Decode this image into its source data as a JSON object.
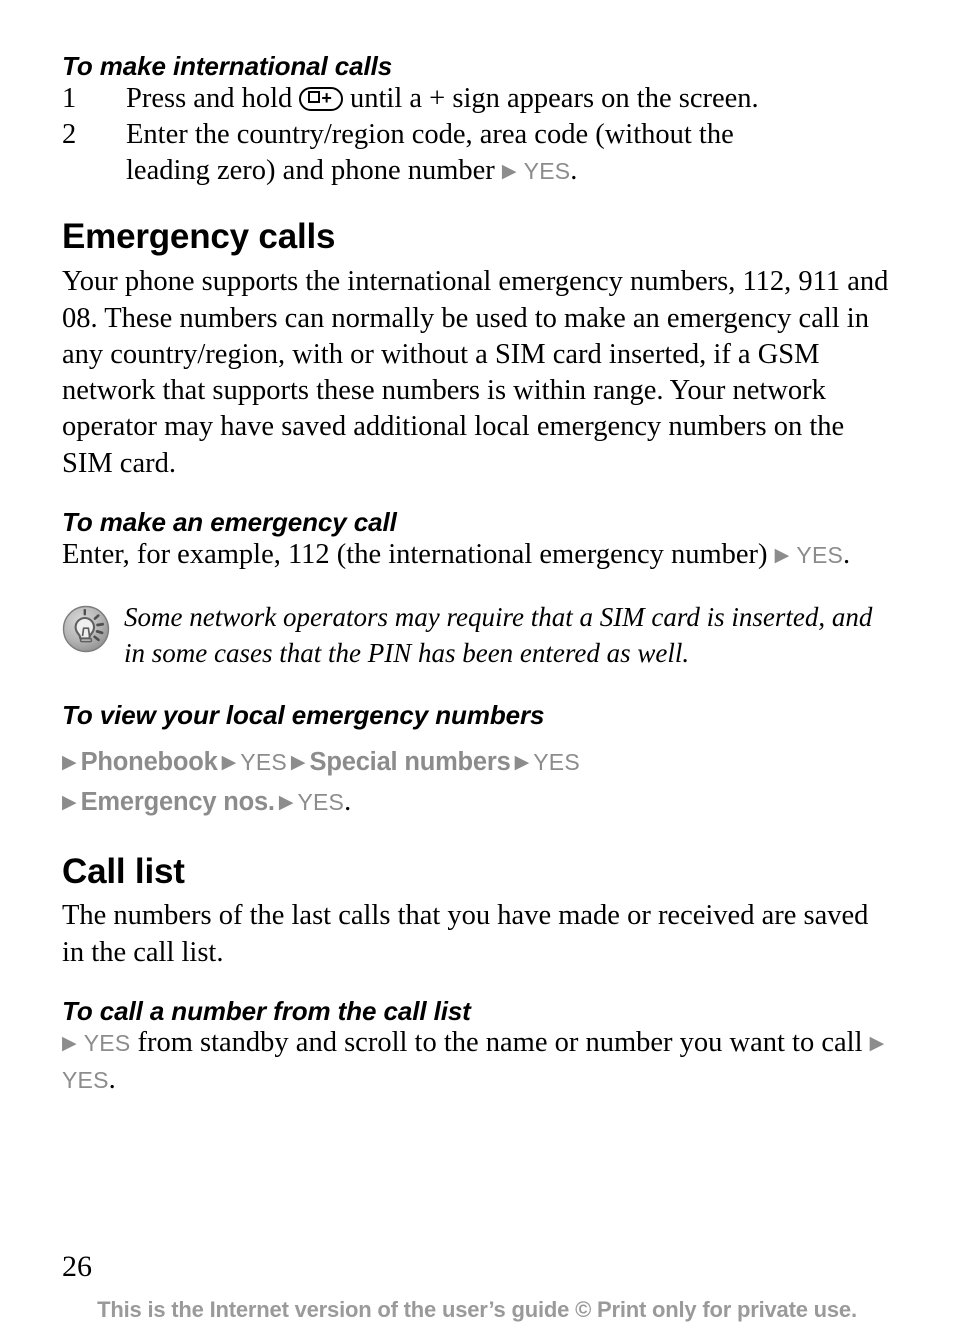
{
  "document": {
    "page_number": "26",
    "footer": "This is the Internet version of the user’s guide © Print only for private use.",
    "colors": {
      "text": "#000000",
      "ui_token_gray": "#8c8c8c",
      "footer_gray": "#9a9a9a",
      "icon_gray": "#8f8f8f"
    }
  },
  "sections": {
    "international_calls": {
      "heading": "To make international calls",
      "steps": [
        {
          "number": "1",
          "text_before_key": "Press and hold ",
          "key_glyph": {
            "name": "key-zero-plus",
            "zero": "0",
            "plus": "+"
          },
          "text_after_key": " until a + sign appears on the screen."
        },
        {
          "number": "2",
          "line1": "Enter the country/region code, area code (without the",
          "line2_before": "leading zero) and phone number",
          "arrow": "▶",
          "yes": "YES",
          "line2_after": "."
        }
      ]
    },
    "emergency_calls": {
      "heading": "Emergency calls",
      "paragraph": "Your phone supports the international emergency numbers, 112, 911 and 08. These numbers can normally be used to make an emergency call in any country/region, with or without a SIM card inserted, if a GSM network that supports these numbers is within range. Your network operator may have saved additional local emergency numbers on the SIM card."
    },
    "make_emergency_call": {
      "heading": "To make an emergency call",
      "text_before": "Enter, for example, 112 (the international emergency number)",
      "arrow": "▶",
      "yes": "YES",
      "text_after": ".",
      "note": {
        "icon": "tip-lightbulb-icon",
        "text": "Some network operators may require that a SIM card is inserted, and in some cases that the PIN has been entered as well."
      }
    },
    "view_emergency_numbers": {
      "heading": "To view your local emergency numbers",
      "path_line_1": [
        {
          "type": "arrow",
          "text": "▶"
        },
        {
          "type": "menu",
          "text": "Phonebook"
        },
        {
          "type": "arrow",
          "text": "▶"
        },
        {
          "type": "yes",
          "text": "YES"
        },
        {
          "type": "arrow",
          "text": "▶"
        },
        {
          "type": "menu",
          "text": "Special numbers"
        },
        {
          "type": "arrow",
          "text": "▶"
        },
        {
          "type": "yes",
          "text": "YES"
        }
      ],
      "path_line_2": [
        {
          "type": "arrow",
          "text": "▶"
        },
        {
          "type": "menu",
          "text": "Emergency nos."
        },
        {
          "type": "arrow",
          "text": "▶"
        },
        {
          "type": "yes",
          "text": "YES"
        },
        {
          "type": "period",
          "text": "."
        }
      ]
    },
    "call_list": {
      "heading": "Call list",
      "paragraph": "The numbers of the last calls that you have made or received are saved in the call list."
    },
    "call_from_list": {
      "heading": "To call a number from the call list",
      "arrow_1": "▶",
      "yes_1": "YES",
      "text_middle": " from standby and scroll to the name or number you want to call",
      "arrow_2": "▶",
      "yes_2": "YES",
      "text_end": "."
    }
  }
}
